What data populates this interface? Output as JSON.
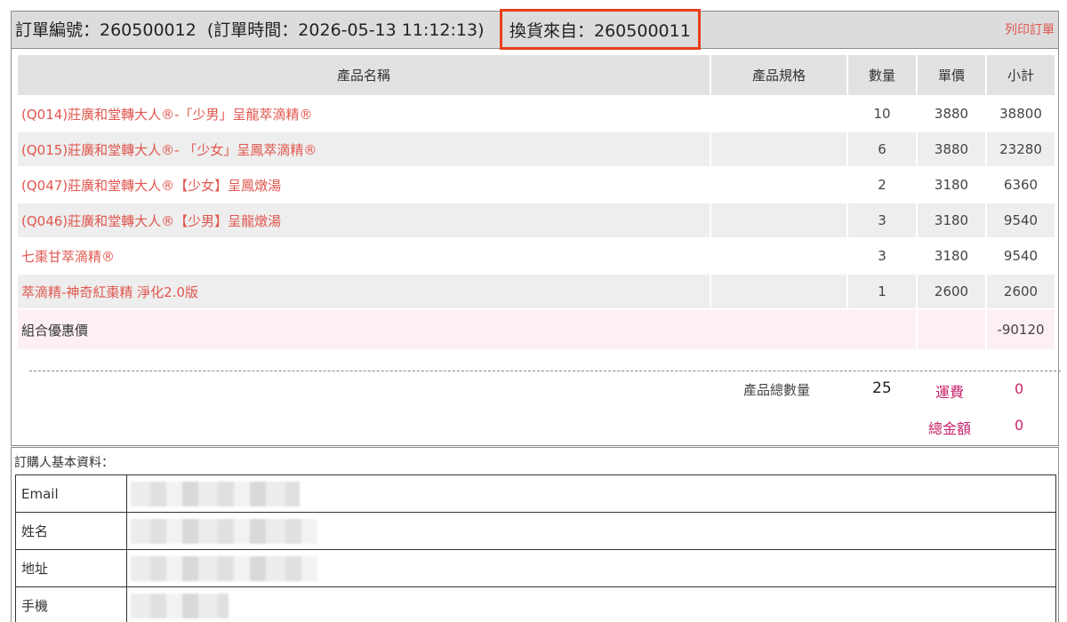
{
  "order": {
    "number_text": "訂單編號：260500012",
    "time_text": "(訂單時間：2026-05-13 11:12:13)",
    "exchange_text": "換貨來自：260500011",
    "print_label": "列印訂單"
  },
  "table": {
    "headers": [
      "產品名稱",
      "產品規格",
      "數量",
      "單價",
      "小計"
    ],
    "rows": [
      {
        "name": "(Q014)莊廣和堂轉大人®-「少男」呈龍萃滴精®",
        "spec": "",
        "qty": "10",
        "price": "3880",
        "subtotal": "38800"
      },
      {
        "name": "(Q015)莊廣和堂轉大人®- 「少女」呈鳳萃滴精®",
        "spec": "",
        "qty": "6",
        "price": "3880",
        "subtotal": "23280"
      },
      {
        "name": "(Q047)莊廣和堂轉大人®【少女】呈鳳燉湯",
        "spec": "",
        "qty": "2",
        "price": "3180",
        "subtotal": "6360"
      },
      {
        "name": "(Q046)莊廣和堂轉大人®【少男】呈龍燉湯",
        "spec": "",
        "qty": "3",
        "price": "3180",
        "subtotal": "9540"
      },
      {
        "name": "七棗甘萃滴精®",
        "spec": "",
        "qty": "3",
        "price": "3180",
        "subtotal": "9540"
      },
      {
        "name": "萃滴精-神奇紅棗精 淨化2.0版",
        "spec": "",
        "qty": "1",
        "price": "2600",
        "subtotal": "2600"
      }
    ],
    "combo": {
      "label": "組合優惠價",
      "value": "-90120"
    }
  },
  "summary": {
    "total_qty_label": "產品總數量",
    "total_qty": "25",
    "shipping_label": "運費",
    "shipping": "0",
    "total_label": "總金額",
    "total": "0"
  },
  "buyer": {
    "title": "訂購人基本資料：",
    "fields": [
      {
        "label": "Email"
      },
      {
        "label": "姓名"
      },
      {
        "label": "地址"
      },
      {
        "label": "手機"
      }
    ]
  },
  "colors": {
    "accent_red": "#e0574f",
    "highlight_border": "#e8401c",
    "summary_magenta": "#c8236b"
  }
}
